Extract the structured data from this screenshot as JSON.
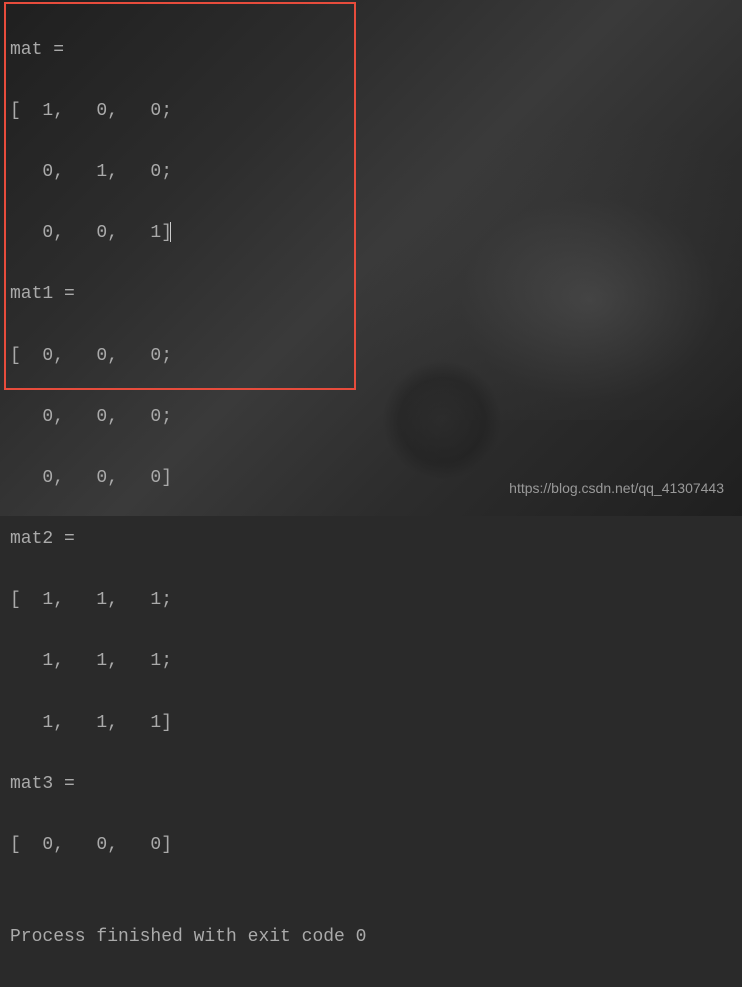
{
  "output": {
    "lines": [
      "mat =",
      "[  1,   0,   0;",
      "   0,   1,   0;",
      "   0,   0,   1]",
      "mat1 =",
      "[  0,   0,   0;",
      "   0,   0,   0;",
      "   0,   0,   0]",
      "mat2 =",
      "[  1,   1,   1;",
      "   1,   1,   1;",
      "   1,   1,   1]",
      "mat3 =",
      "[  0,   0,   0]",
      "",
      "Process finished with exit code 0"
    ]
  },
  "matrices": {
    "mat": [
      [
        1,
        0,
        0
      ],
      [
        0,
        1,
        0
      ],
      [
        0,
        0,
        1
      ]
    ],
    "mat1": [
      [
        0,
        0,
        0
      ],
      [
        0,
        0,
        0
      ],
      [
        0,
        0,
        0
      ]
    ],
    "mat2": [
      [
        1,
        1,
        1
      ],
      [
        1,
        1,
        1
      ],
      [
        1,
        1,
        1
      ]
    ],
    "mat3": [
      [
        0,
        0,
        0
      ]
    ]
  },
  "exit_code": 0,
  "watermark": "https://blog.csdn.net/qq_41307443"
}
